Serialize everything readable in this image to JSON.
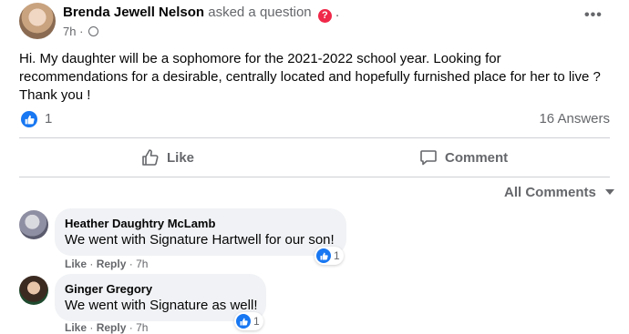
{
  "post": {
    "author": "Brenda Jewell Nelson",
    "action": "asked a question",
    "time": "7h",
    "text": "Hi.  My daughter will be a sophomore for the 2021-2022 school year.  Looking for recommendations for a desirable, centrally located and hopefully furnished place for her to live ? Thank you !",
    "like_count": "1",
    "answers": "16 Answers"
  },
  "actions": {
    "like": "Like",
    "comment": "Comment"
  },
  "sort": {
    "label": "All Comments"
  },
  "comments": [
    {
      "name": "Heather Daughtry McLamb",
      "text": "We went with Signature Hartwell for our son!",
      "reactions": "1",
      "like": "Like",
      "reply": "Reply",
      "time": "7h"
    },
    {
      "name": "Ginger Gregory",
      "text": "We went with Signature as well!",
      "reactions": "1",
      "like": "Like",
      "reply": "Reply",
      "time": "7h"
    }
  ],
  "colors": {
    "accent": "#1877f2",
    "question": "#f02849",
    "muted": "#65676b",
    "bubble": "#f0f2f5"
  },
  "icons": [
    "question-icon",
    "globe-icon",
    "more-icon",
    "like-reaction-icon",
    "thumbs-up-icon",
    "comment-icon",
    "caret-down-icon"
  ]
}
